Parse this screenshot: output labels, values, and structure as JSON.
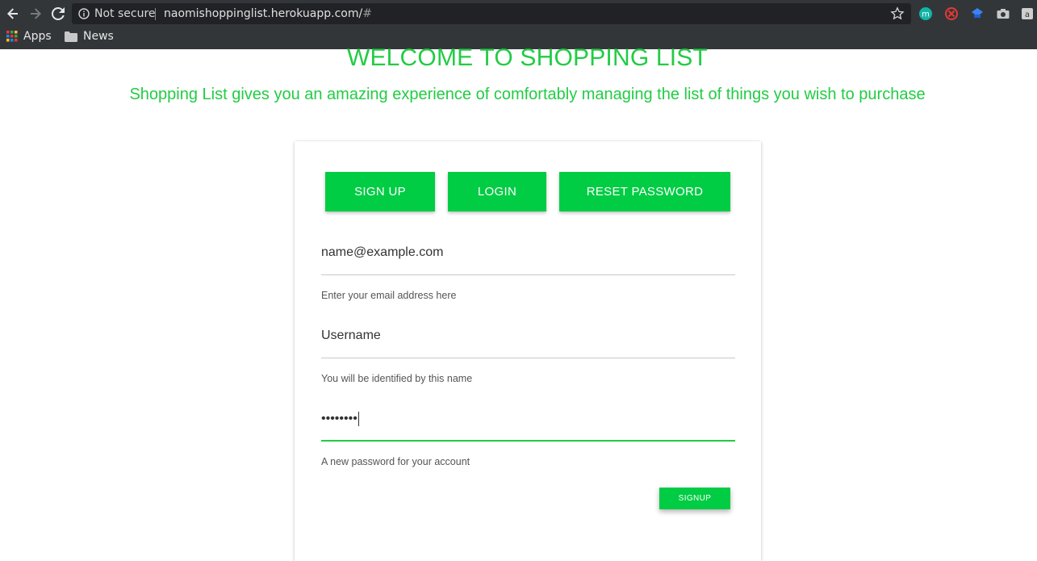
{
  "browser": {
    "security_label": "Not secure",
    "url_host": "naomishoppinglist.herokuapp.com/",
    "url_hash": "#",
    "bookmarks": [
      {
        "label": "Apps",
        "icon": "apps-grid-icon"
      },
      {
        "label": "News",
        "icon": "folder-icon"
      }
    ],
    "extensions": [
      {
        "name": "m-extension-icon",
        "letter": "m",
        "color": "#12b5a6"
      },
      {
        "name": "blocker-extension-icon",
        "color": "#e53935"
      },
      {
        "name": "blue-extension-icon",
        "color": "#3b82f6"
      },
      {
        "name": "camera-extension-icon",
        "color": "#c8c8c8"
      },
      {
        "name": "a-extension-icon",
        "letter": "a",
        "color": "#cfcfcf"
      }
    ]
  },
  "page": {
    "title": "WELCOME TO SHOPPING LIST",
    "subtitle": "Shopping List gives you an amazing experience of comfortably managing the list of things you wish to purchase"
  },
  "tabs": {
    "signup": "SIGN UP",
    "login": "LOGIN",
    "reset": "RESET PASSWORD"
  },
  "form": {
    "email": {
      "value": "name@example.com",
      "help": "Enter your email address here"
    },
    "username": {
      "value": "Username",
      "help": "You will be identified by this name"
    },
    "password": {
      "value": "••••••••",
      "help": "A new password for your account"
    },
    "submit_label": "SIGNUP"
  },
  "colors": {
    "accent": "#00cc44",
    "text_green": "#22cc44",
    "chrome_bg": "#333639"
  }
}
